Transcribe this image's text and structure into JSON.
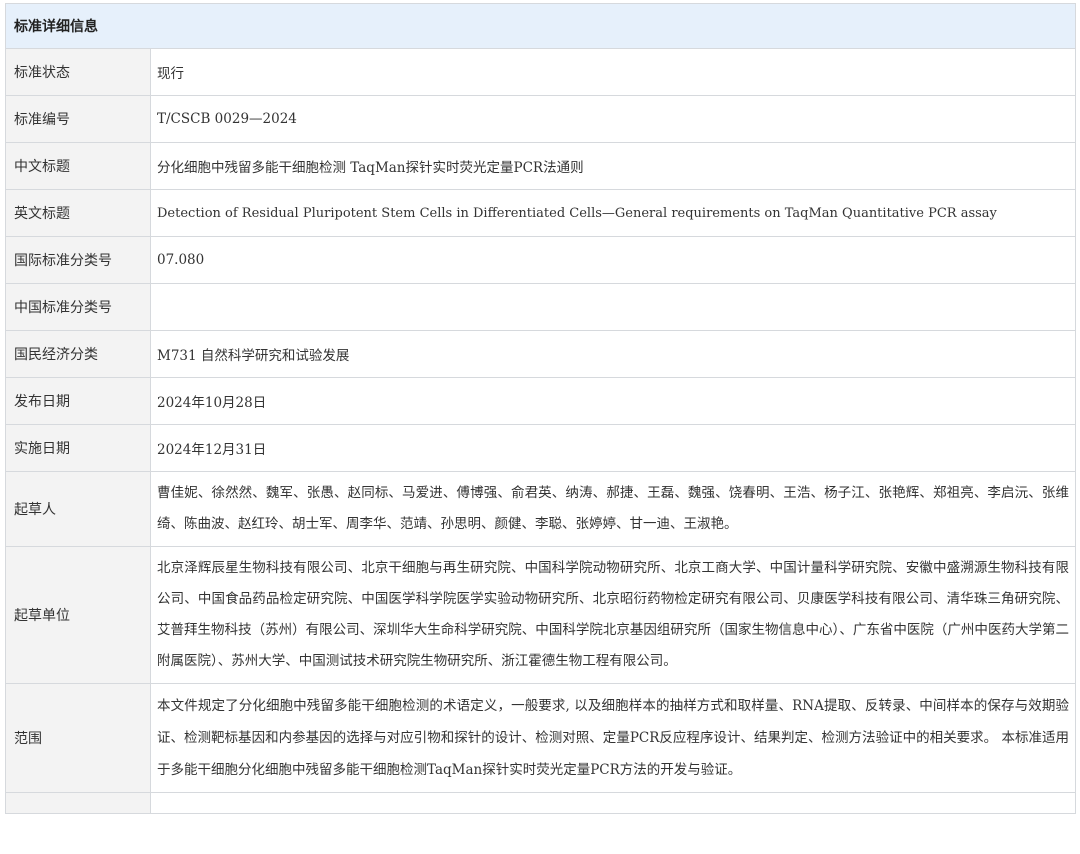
{
  "section_title": "标准详细信息",
  "rows": {
    "status": {
      "label": "标准状态",
      "value": "现行"
    },
    "code": {
      "label": "标准编号",
      "value": "T/CSCB 0029—2024"
    },
    "cn_title": {
      "label": "中文标题",
      "value": "分化细胞中残留多能干细胞检测 TaqMan探针实时荧光定量PCR法通则"
    },
    "en_title": {
      "label": "英文标题",
      "value": "Detection of Residual Pluripotent Stem Cells in Differentiated Cells—General requirements on TaqMan Quantitative PCR assay"
    },
    "ics": {
      "label": "国际标准分类号",
      "value": "07.080"
    },
    "ccs": {
      "label": "中国标准分类号",
      "value": ""
    },
    "economy": {
      "label": "国民经济分类",
      "value": "M731 自然科学研究和试验发展"
    },
    "publish_date": {
      "label": "发布日期",
      "value": "2024年10月28日"
    },
    "implement_date": {
      "label": "实施日期",
      "value": "2024年12月31日"
    },
    "drafters": {
      "label": "起草人",
      "value": "曹佳妮、徐然然、魏军、张愚、赵同标、马爱进、傅博强、俞君英、纳涛、郝捷、王磊、魏强、饶春明、王浩、杨子江、张艳辉、郑祖亮、李启沅、张维绮、陈曲波、赵红玲、胡士军、周李华、范靖、孙思明、颜健、李聪、张婷婷、甘一迪、王淑艳。"
    },
    "drafting_units": {
      "label": "起草单位",
      "value": "北京泽辉辰星生物科技有限公司、北京干细胞与再生研究院、中国科学院动物研究所、北京工商大学、中国计量科学研究院、安徽中盛溯源生物科技有限公司、中国食品药品检定研究院、中国医学科学院医学实验动物研究所、北京昭衍药物检定研究有限公司、贝康医学科技有限公司、清华珠三角研究院、艾普拜生物科技（苏州）有限公司、深圳华大生命科学研究院、中国科学院北京基因组研究所（国家生物信息中心）、广东省中医院（广州中医药大学第二附属医院）、苏州大学、中国测试技术研究院生物研究所、浙江霍德生物工程有限公司。"
    },
    "scope": {
      "label": "范围",
      "value": "本文件规定了分化细胞中残留多能干细胞检测的术语定义，一般要求, 以及细胞样本的抽样方式和取样量、RNA提取、反转录、中间样本的保存与效期验证、检测靶标基因和内参基因的选择与对应引物和探针的设计、检测对照、定量PCR反应程序设计、结果判定、检测方法验证中的相关要求。 本标准适用于多能干细胞分化细胞中残留多能干细胞检测TaqMan探针实时荧光定量PCR方法的开发与验证。"
    }
  }
}
